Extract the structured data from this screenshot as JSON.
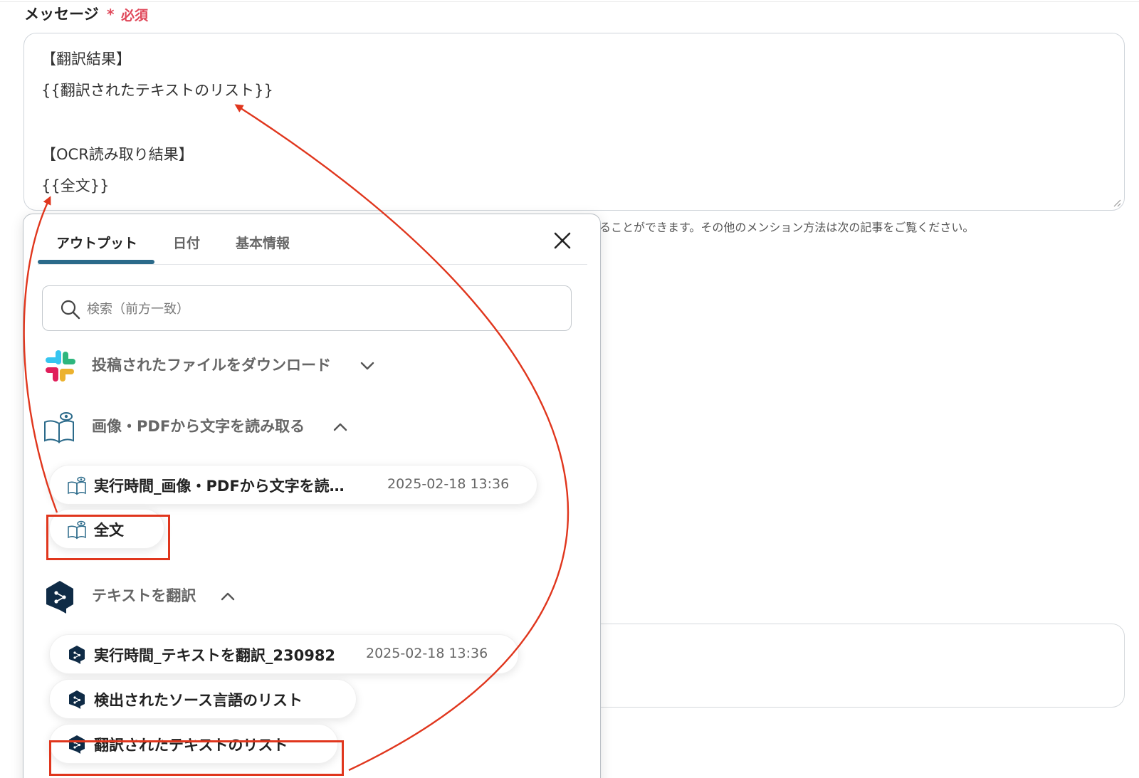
{
  "form": {
    "label": "メッセージ",
    "required_mark": "*",
    "required_text": "必須",
    "message_lines": [
      "【翻訳結果】",
      "{{翻訳されたテキストのリスト}}",
      "【OCR読み取り結果】",
      "{{全文}}"
    ],
    "help_text": "ることができます。その他のメンション方法は次の記事をご覧ください。"
  },
  "popup": {
    "tabs": [
      "アウトプット",
      "日付",
      "基本情報"
    ],
    "active_tab": "アウトプット",
    "search_placeholder": "検索（前方一致）",
    "sections": [
      {
        "icon": "slack-icon",
        "title": "投稿されたファイルをダウンロード",
        "expanded": false
      },
      {
        "icon": "ocr-book-icon",
        "title": "画像・PDFから文字を読み取る",
        "expanded": true,
        "items": [
          {
            "label": "実行時間_画像・PDFから文字を読…",
            "time": "2025-02-18 13:36"
          },
          {
            "label": "全文"
          }
        ]
      },
      {
        "icon": "deepl-icon",
        "title": "テキストを翻訳",
        "expanded": true,
        "items": [
          {
            "label": "実行時間_テキストを翻訳_230982",
            "time": "2025-02-18 13:36"
          },
          {
            "label": "検出されたソース言語のリスト"
          },
          {
            "label": "翻訳されたテキストのリスト"
          }
        ]
      }
    ]
  },
  "colors": {
    "accent_tab": "#2b6a8a",
    "highlight": "#e0361d",
    "required": "#e0485a",
    "deepl_dark": "#0f2b46"
  }
}
